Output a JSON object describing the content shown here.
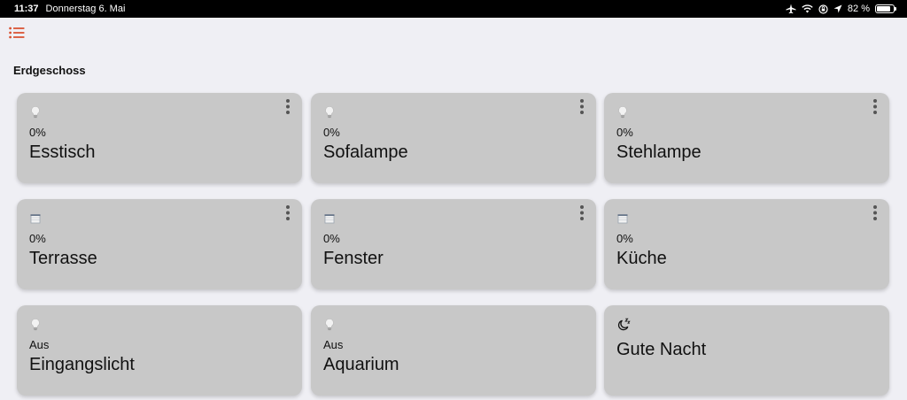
{
  "statusbar": {
    "time": "11:37",
    "date": "Donnerstag 6. Mai",
    "battery_text": "82 %",
    "battery_level": 0.82
  },
  "header": {
    "menu_icon": "list-icon",
    "accent_color": "#d9502f"
  },
  "section": {
    "title": "Erdgeschoss"
  },
  "cards": [
    {
      "icon": "lightbulb-icon",
      "state": "0%",
      "name": "Esstisch",
      "has_menu": true
    },
    {
      "icon": "lightbulb-icon",
      "state": "0%",
      "name": "Sofalampe",
      "has_menu": true
    },
    {
      "icon": "lightbulb-icon",
      "state": "0%",
      "name": "Stehlampe",
      "has_menu": true
    },
    {
      "icon": "blind-icon",
      "state": "0%",
      "name": "Terrasse",
      "has_menu": true
    },
    {
      "icon": "blind-icon",
      "state": "0%",
      "name": "Fenster",
      "has_menu": true
    },
    {
      "icon": "blind-icon",
      "state": "0%",
      "name": "Küche",
      "has_menu": true
    },
    {
      "icon": "lightbulb-icon",
      "state": "Aus",
      "name": "Eingangslicht",
      "has_menu": false
    },
    {
      "icon": "lightbulb-icon",
      "state": "Aus",
      "name": "Aquarium",
      "has_menu": false
    },
    {
      "icon": "moon-sleep-icon",
      "state": "",
      "name": "Gute Nacht",
      "has_menu": false
    }
  ]
}
